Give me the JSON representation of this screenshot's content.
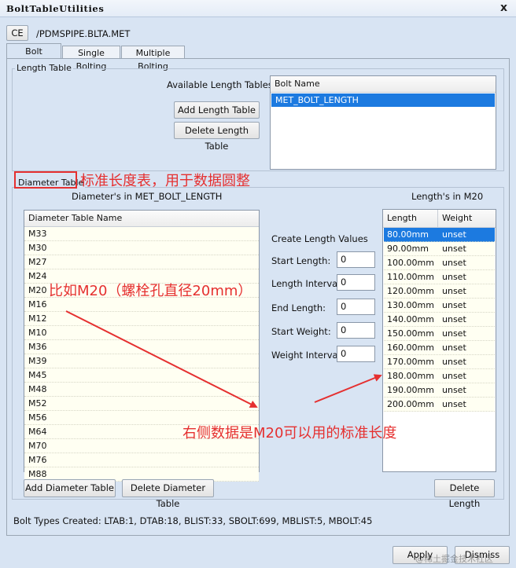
{
  "window": {
    "title": "BoltTableUtilities",
    "close": "x"
  },
  "ce_button": "CE",
  "file_path": "/PDMSPIPE.BLTA.MET",
  "tabs": [
    {
      "label": "Bolt Lengths",
      "active": true
    },
    {
      "label": "Single Bolting",
      "active": false
    },
    {
      "label": "Multiple Bolting",
      "active": false
    }
  ],
  "length_table": {
    "group_label": "Length Table",
    "available_label": "Available Length Tables",
    "add_button": "Add Length Table",
    "delete_button": "Delete Length Table",
    "column": "Bolt Name",
    "rows": [
      "MET_BOLT_LENGTH"
    ],
    "selected_index": 0
  },
  "diameter_table": {
    "group_label": "Diameter Table",
    "caption": "Diameter's in MET_BOLT_LENGTH",
    "column": "Diameter Table Name",
    "rows": [
      "M33",
      "M30",
      "M27",
      "M24",
      "M20",
      "M16",
      "M12",
      "M10",
      "M36",
      "M39",
      "M45",
      "M48",
      "M52",
      "M56",
      "M64",
      "M70",
      "M76",
      "M88"
    ],
    "add_button": "Add Diameter Table",
    "delete_button": "Delete Diameter Table"
  },
  "create_values": {
    "title": "Create Length Values",
    "start_length": {
      "label": "Start Length:",
      "value": "0"
    },
    "length_interval": {
      "label": "Length Interval:",
      "value": "0"
    },
    "end_length": {
      "label": "End Length:",
      "value": "0"
    },
    "start_weight": {
      "label": "Start Weight:",
      "value": "0"
    },
    "weight_interval": {
      "label": "Weight Interval:",
      "value": "0"
    }
  },
  "lengths": {
    "caption": "Length's in M20",
    "columns": [
      "Length",
      "Weight"
    ],
    "rows": [
      [
        "80.00mm",
        "unset"
      ],
      [
        "90.00mm",
        "unset"
      ],
      [
        "100.00mm",
        "unset"
      ],
      [
        "110.00mm",
        "unset"
      ],
      [
        "120.00mm",
        "unset"
      ],
      [
        "130.00mm",
        "unset"
      ],
      [
        "140.00mm",
        "unset"
      ],
      [
        "150.00mm",
        "unset"
      ],
      [
        "160.00mm",
        "unset"
      ],
      [
        "170.00mm",
        "unset"
      ],
      [
        "180.00mm",
        "unset"
      ],
      [
        "190.00mm",
        "unset"
      ],
      [
        "200.00mm",
        "unset"
      ]
    ],
    "selected_index": 0,
    "delete_button": "Delete Length"
  },
  "status": "Bolt Types Created: LTAB:1, DTAB:18, BLIST:33, SBOLT:699, MBLIST:5, MBOLT:45",
  "footer": {
    "apply": "Apply",
    "dismiss": "Dismiss",
    "watermark": "@稀土掘金技术社区"
  },
  "annotations": {
    "note1": "标准长度表，用于数据圆整",
    "note2": "比如M20（螺栓孔直径20mm）",
    "note3": "右侧数据是M20可以用的标准长度",
    "color": "#e53030"
  }
}
